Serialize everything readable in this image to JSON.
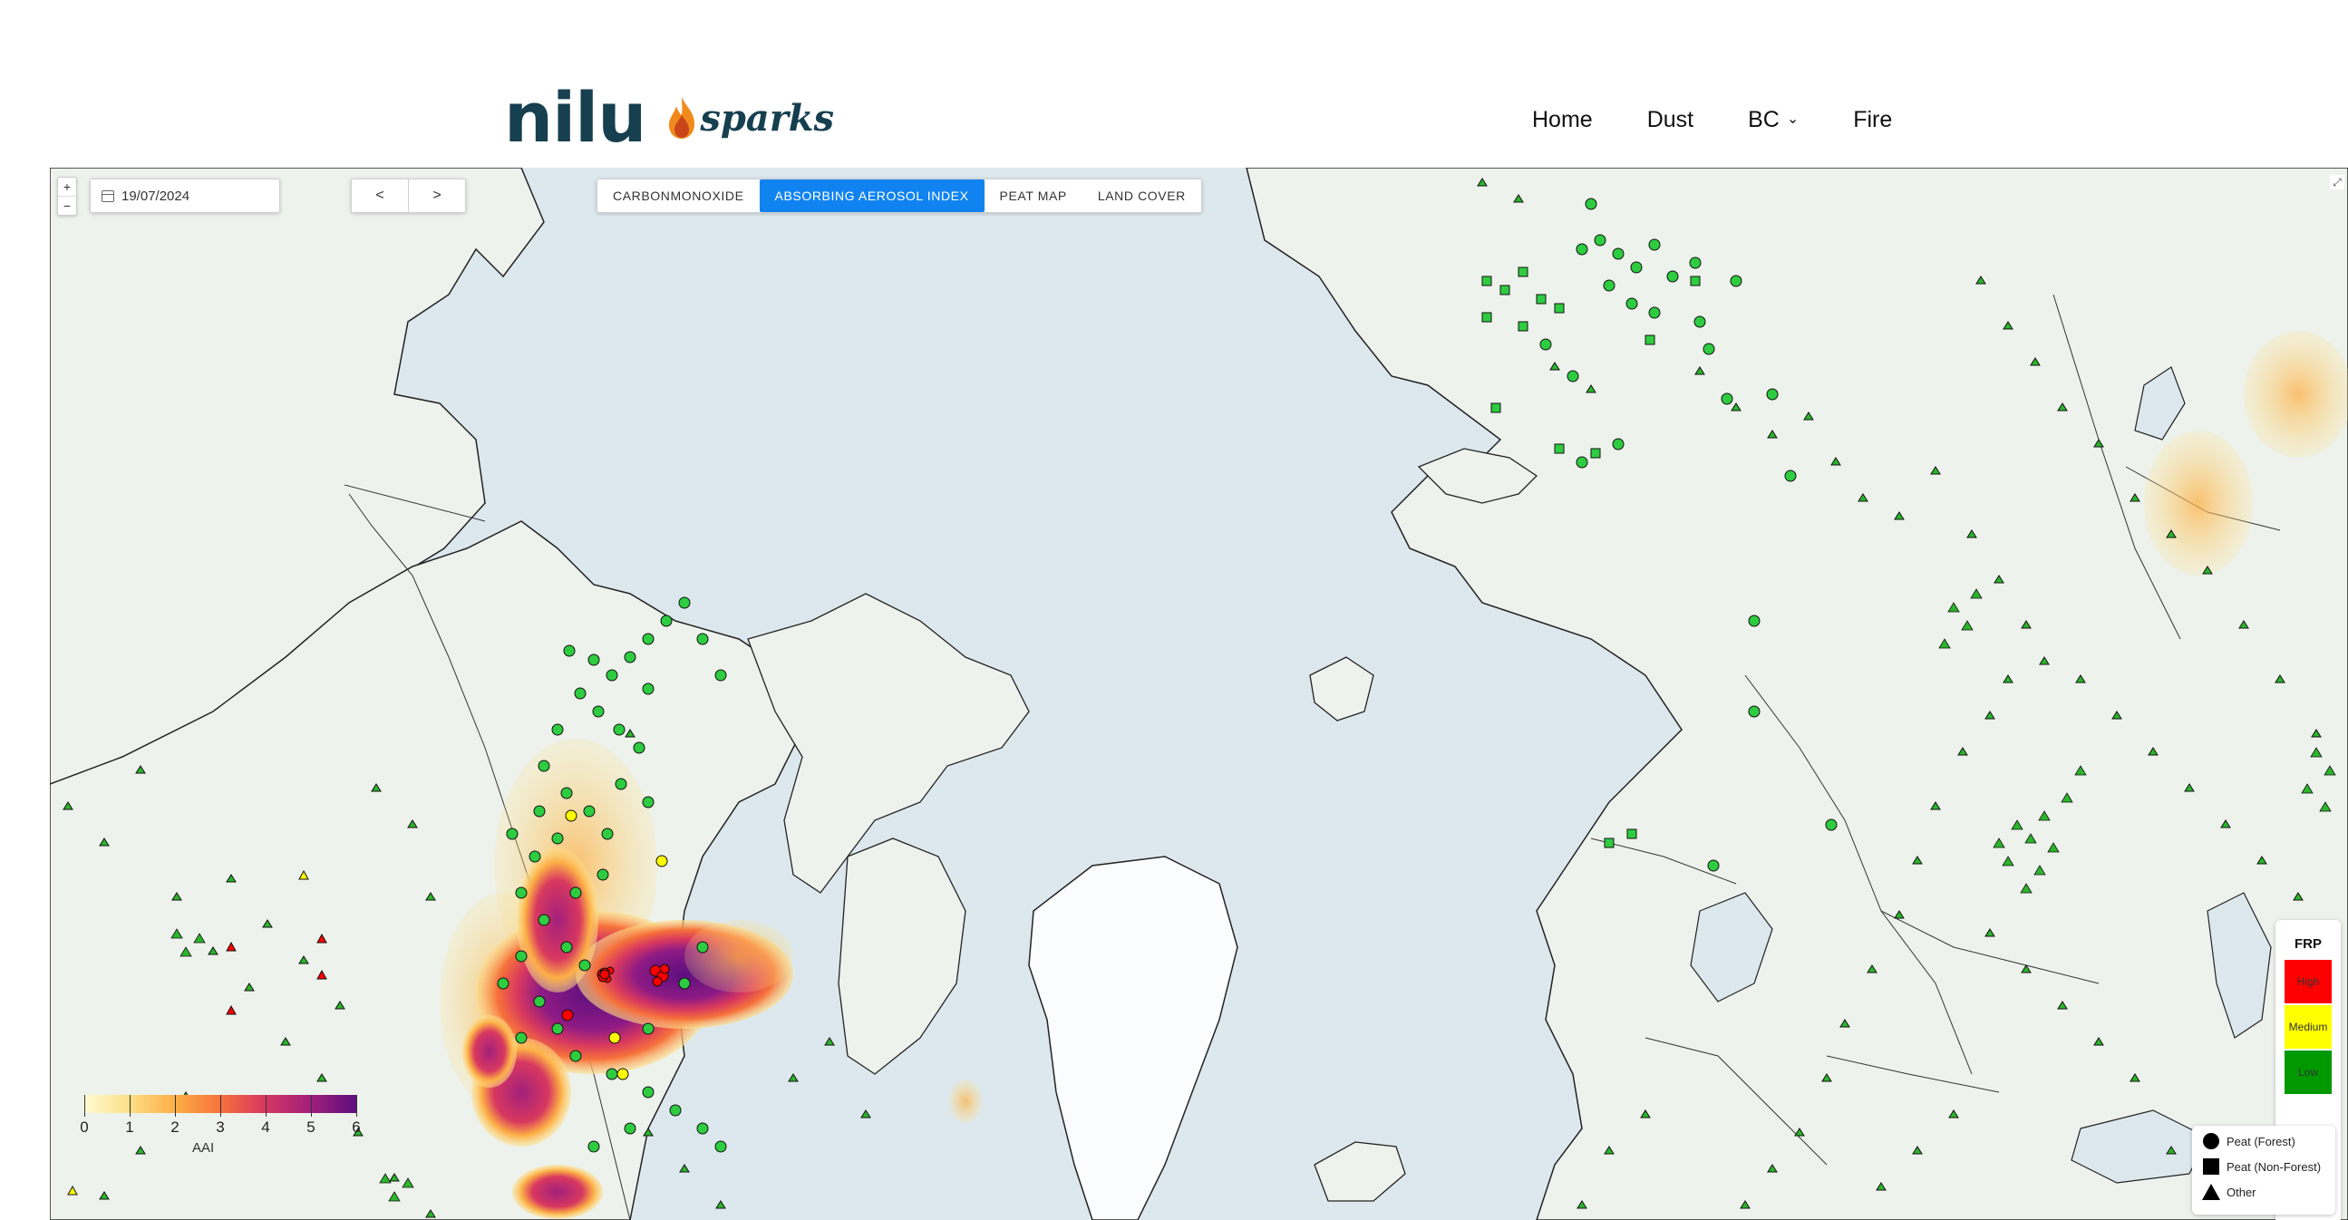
{
  "header": {
    "logo_text": "nilu",
    "brand_text": "sparks",
    "nav": [
      {
        "label": "Home"
      },
      {
        "label": "Dust"
      },
      {
        "label": "BC",
        "has_dropdown": true
      },
      {
        "label": "Fire"
      }
    ]
  },
  "map": {
    "zoom_in": "+",
    "zoom_out": "−",
    "date": "19/07/2024",
    "prev_label": "<",
    "next_label": ">",
    "layers": [
      {
        "label": "CARBONMONOXIDE",
        "active": false
      },
      {
        "label": "ABSORBING AEROSOL INDEX",
        "active": true
      },
      {
        "label": "PEAT MAP",
        "active": false
      },
      {
        "label": "LAND COVER",
        "active": false
      }
    ],
    "colorbar": {
      "label": "AAI",
      "ticks": [
        "0",
        "1",
        "2",
        "3",
        "4",
        "5",
        "6"
      ],
      "range": [
        0,
        6
      ],
      "colors": [
        "#fffbd0",
        "#fde08a",
        "#fdb046",
        "#f6713b",
        "#d8385f",
        "#a21f7c",
        "#5c0f7e"
      ]
    },
    "frp_legend": {
      "title": "FRP",
      "levels": [
        {
          "label": "High",
          "color": "#ff0000"
        },
        {
          "label": "Medium",
          "color": "#ffff00"
        },
        {
          "label": "Low",
          "color": "#009900"
        }
      ]
    },
    "shape_legend": [
      {
        "label": "Peat (Forest)",
        "shape": "circle"
      },
      {
        "label": "Peat (Non-Forest)",
        "shape": "square"
      },
      {
        "label": "Other",
        "shape": "triangle"
      }
    ]
  },
  "colors": {
    "accent": "#1183f0",
    "logo": "#163f4f",
    "fire_low": "#2ecc40",
    "fire_other": "#2bb52b",
    "ocean": "#dfe9ef",
    "land": "#eef2ec"
  }
}
